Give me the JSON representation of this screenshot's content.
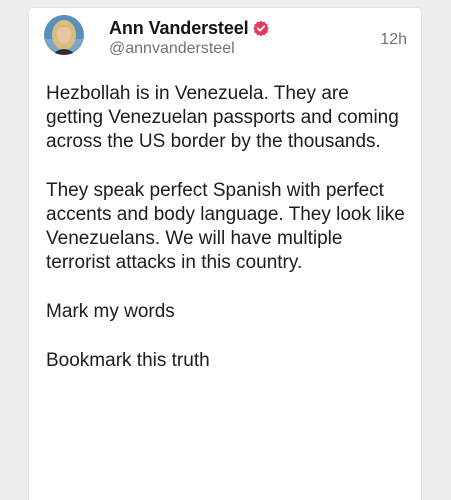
{
  "post": {
    "author": {
      "display_name": "Ann Vandersteel",
      "handle": "@annvandersteel",
      "verified_badge_icon": "verified-badge-icon",
      "verified_color": "#e8385b"
    },
    "timestamp": "12h",
    "paragraphs": [
      "Hezbollah is in Venezuela. They are getting Venezuelan passports and coming across the US border by the thousands.",
      "They speak perfect Spanish with perfect accents and body language. They look like Venezuelans. We will have multiple terrorist attacks in this country.",
      "Mark my words",
      "Bookmark this truth"
    ]
  }
}
